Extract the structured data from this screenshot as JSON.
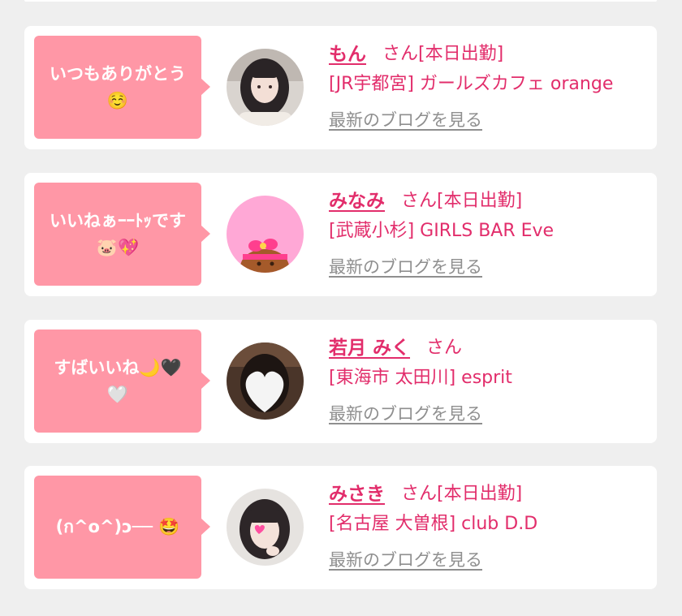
{
  "cards": [
    {
      "comment": "いつもありがとう\n☺️",
      "name": "もん",
      "honorific": "さん",
      "attendance": "[本日出勤]",
      "shop": "[JR宇都宮] ガールズカフェ orange",
      "blog_link": "最新のブログを見る",
      "avatar_icon": "avatar-photo"
    },
    {
      "comment": "いいねぁｰｰﾄｯです\n🐷💖",
      "name": "みなみ",
      "honorific": "さん",
      "attendance": "[本日出勤]",
      "shop": "[武蔵小杉] GIRLS BAR Eve",
      "blog_link": "最新のブログを見る",
      "avatar_icon": "cat-character-avatar"
    },
    {
      "comment": "すばいいね🌙🖤\n🤍",
      "name": "若月 みく",
      "honorific": "さん",
      "attendance": "",
      "shop": "[東海市 太田川] esprit",
      "blog_link": "最新のブログを見る",
      "avatar_icon": "heart-covered-avatar"
    },
    {
      "comment": "(ก^o^)ɔ── 🤩",
      "name": "みさき",
      "honorific": "さん",
      "attendance": "[本日出勤]",
      "shop": "[名古屋 大曽根] club D.D",
      "blog_link": "最新のブログを見る",
      "avatar_icon": "avatar-photo"
    }
  ],
  "colors": {
    "accent": "#e22d6b",
    "bubble": "#ff97a6",
    "link_gray": "#8f8f8f",
    "background": "#efefef"
  }
}
